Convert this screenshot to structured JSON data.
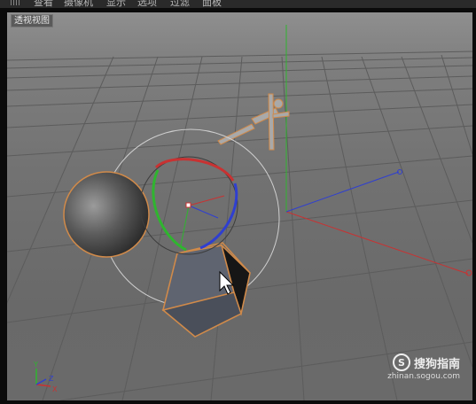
{
  "menubar": {
    "items": [
      "查看",
      "摄像机",
      "显示",
      "选项",
      "过滤",
      "面板"
    ]
  },
  "viewport": {
    "label": "透视视图",
    "axes": {
      "y": "Y",
      "z": "Z",
      "x": "X"
    }
  },
  "watermark": {
    "brand": "搜狗指南",
    "logo_letter": "S",
    "url": "zhinan.sogou.com"
  },
  "colors": {
    "grid": "#5f5f5f",
    "x_axis": "#c83232",
    "y_axis": "#2fb52f",
    "z_axis": "#2f3fd0",
    "selection_outline": "#d08a4a"
  }
}
